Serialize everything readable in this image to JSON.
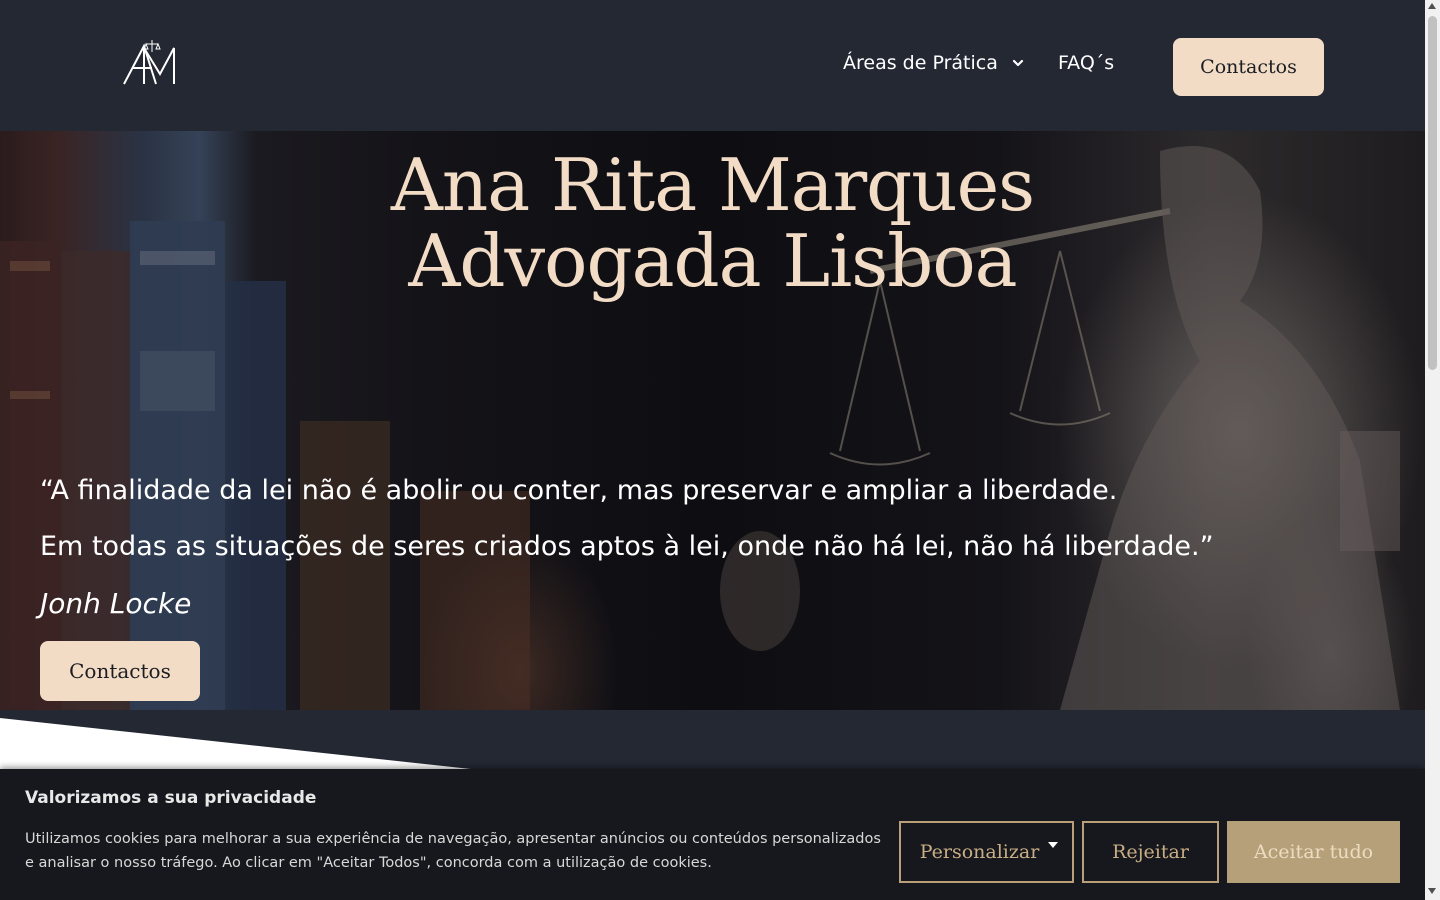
{
  "header": {
    "logo_text": "AM",
    "nav": {
      "areas_label": "Áreas de Prática",
      "faq_label": "FAQ´s"
    },
    "contact_button": "Contactos"
  },
  "hero": {
    "title_line1": "Ana Rita Marques",
    "title_line2": "Advogada Lisboa",
    "quote_line1": "“A finalidade da lei não é abolir ou conter, mas preservar e ampliar a liberdade.",
    "quote_line2": "Em todas as situações de seres criados aptos à lei, onde não há lei, não há liberdade.”",
    "author": "Jonh Locke",
    "contact_button": "Contactos"
  },
  "cookie_banner": {
    "title": "Valorizamos a sua privacidade",
    "text": "Utilizamos cookies para melhorar a sua experiência de navegação, apresentar anúncios ou conteúdos personalizados e analisar o nosso tráfego. Ao clicar em \"Aceitar Todos\", concorda com a utilização de cookies.",
    "customize_label": "Personalizar",
    "reject_label": "Rejeitar",
    "accept_label": "Aceitar tudo"
  },
  "colors": {
    "background": "#232833",
    "accent": "#f2dcc6",
    "cookie_gold": "#b5a07a"
  }
}
